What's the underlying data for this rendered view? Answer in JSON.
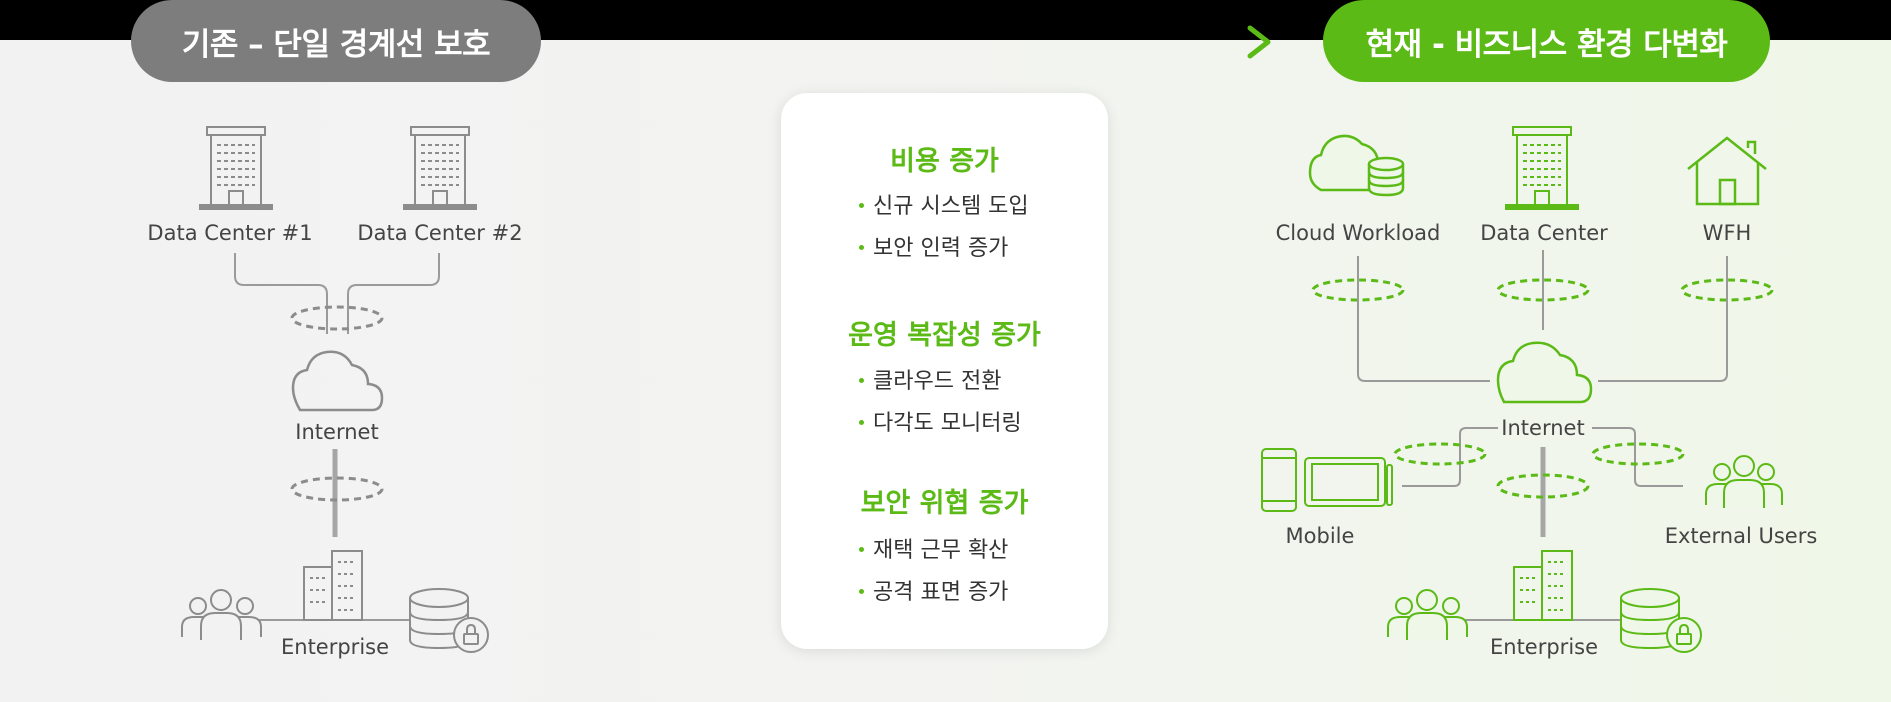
{
  "left_panel": {
    "title": "기존 – 단일 경계선 보호",
    "labels": {
      "dc1": "Data Center #1",
      "dc2": "Data Center #2",
      "internet": "Internet",
      "enterprise": "Enterprise"
    }
  },
  "center_card": {
    "sections": [
      {
        "title": "비용 증가",
        "items": [
          "신규 시스템 도입",
          "보안 인력 증가"
        ]
      },
      {
        "title": "운영 복잡성 증가",
        "items": [
          "클라우드 전환",
          "다각도 모니터링"
        ]
      },
      {
        "title": "보안 위협 증가",
        "items": [
          "재택 근무 확산",
          "공격 표면 증가"
        ]
      }
    ]
  },
  "right_panel": {
    "title": "현재 - 비즈니스 환경 다변화",
    "labels": {
      "cloud_workload": "Cloud Workload",
      "data_center": "Data Center",
      "wfh": "WFH",
      "internet": "Internet",
      "mobile": "Mobile",
      "external_users": "External Users",
      "enterprise": "Enterprise"
    }
  },
  "colors": {
    "accent": "#5cba17",
    "grey": "#7d7d7d",
    "left_bg": "#f2f2f2",
    "right_bg": "#f0f8ea",
    "icon_grey": "#8c8c8c"
  }
}
